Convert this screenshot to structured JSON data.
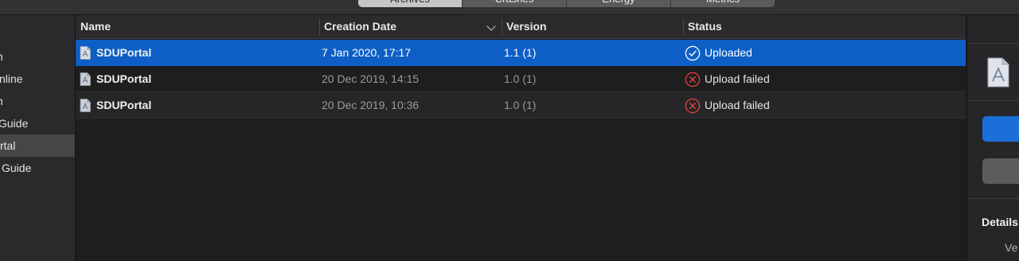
{
  "toolbar": {
    "tabs": [
      {
        "label": "Archives",
        "active": true
      },
      {
        "label": "Crashes",
        "active": false
      },
      {
        "label": "Energy",
        "active": false
      },
      {
        "label": "Metrics",
        "active": false
      }
    ]
  },
  "sidebar": {
    "items": [
      {
        "label": "h",
        "selected": false
      },
      {
        "label": "nline",
        "selected": false
      },
      {
        "label": "n",
        "selected": false
      },
      {
        "label": "Guide",
        "selected": false
      },
      {
        "label": "rtal",
        "selected": true
      },
      {
        "label": "Guide",
        "selected": false
      }
    ]
  },
  "table": {
    "columns": {
      "name": "Name",
      "creation_date": "Creation Date",
      "version": "Version",
      "status": "Status"
    },
    "sort_column": "Creation Date",
    "rows": [
      {
        "name": "SDUPortal",
        "date": "7 Jan 2020, 17:17",
        "version": "1.1 (1)",
        "status": "Uploaded",
        "status_icon": "check-circle-icon",
        "selected": true
      },
      {
        "name": "SDUPortal",
        "date": "20 Dec 2019, 14:15",
        "version": "1.0 (1)",
        "status": "Upload failed",
        "status_icon": "error-x-circle-icon",
        "selected": false
      },
      {
        "name": "SDUPortal",
        "date": "20 Dec 2019, 10:36",
        "version": "1.0 (1)",
        "status": "Upload failed",
        "status_icon": "error-x-circle-icon",
        "selected": false
      }
    ]
  },
  "right_panel": {
    "details_label": "Details",
    "version_label": "Ve"
  },
  "colors": {
    "selection": "#0d5fc6",
    "success": "#ffffff",
    "error": "#e5413a",
    "accent_button": "#1b6fd8"
  }
}
